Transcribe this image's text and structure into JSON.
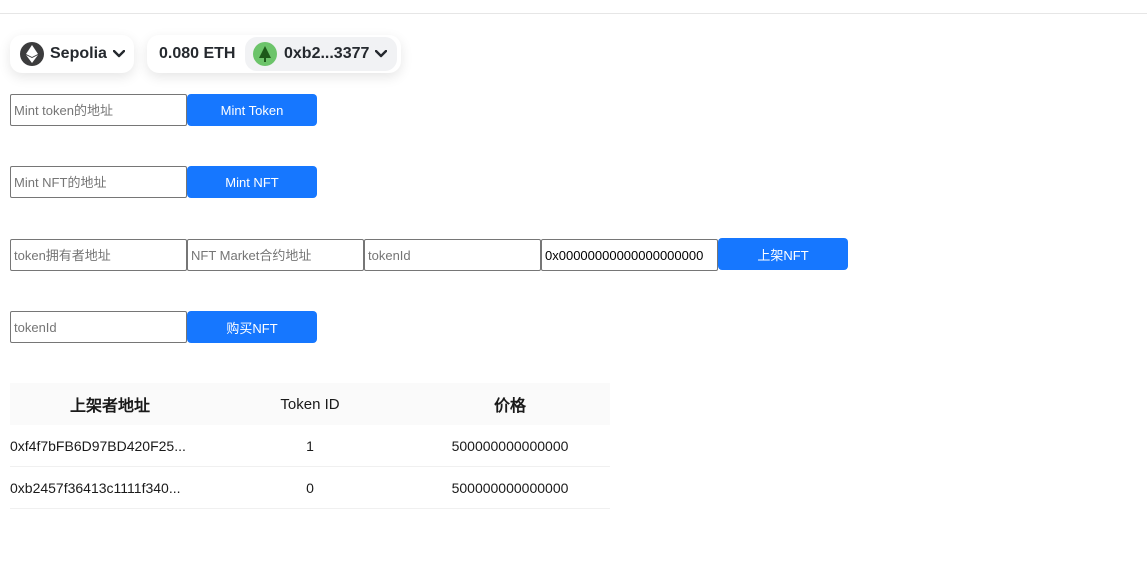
{
  "wallet": {
    "chain_name": "Sepolia",
    "chain_icon": "ethereum-icon",
    "balance": "0.080 ETH",
    "address": "0xb2...3377",
    "avatar_icon": "tree-avatar-icon"
  },
  "forms": {
    "mint_token": {
      "placeholder": "Mint token的地址",
      "button_label": "Mint Token"
    },
    "mint_nft": {
      "placeholder": "Mint NFT的地址",
      "button_label": "Mint NFT"
    },
    "list_nft": {
      "owner_placeholder": "token拥有者地址",
      "market_placeholder": "NFT Market合约地址",
      "token_id_placeholder": "tokenId",
      "price_value": "0x00000000000000000000",
      "button_label": "上架NFT"
    },
    "buy_nft": {
      "token_id_placeholder": "tokenId",
      "button_label": "购买NFT"
    }
  },
  "listings": {
    "columns": [
      "上架者地址",
      "Token ID",
      "价格"
    ],
    "rows": [
      [
        "0xf4f7bFB6D97BD420F25...",
        "1",
        "500000000000000"
      ],
      [
        "0xb2457f36413c1111f340...",
        "0",
        "500000000000000"
      ]
    ]
  },
  "colors": {
    "primary": "#1677ff",
    "avatar": "#6cc46a"
  }
}
